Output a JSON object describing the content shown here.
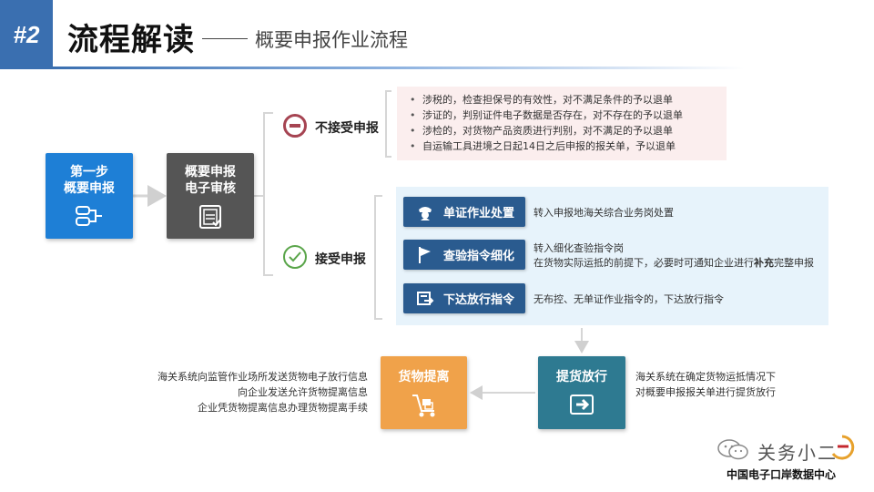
{
  "header": {
    "badge": "#2",
    "title": "流程解读",
    "subtitle": "概要申报作业流程"
  },
  "nodes": {
    "step1_label": "第一步\n概要申报",
    "review_label": "概要申报\n电子审核",
    "reject_label": "不接受申报",
    "accept_label": "接受申报",
    "pickup_label": "货物提离",
    "release_label": "提货放行"
  },
  "reject_reasons": [
    "涉税的，检查担保号的有效性，对不满足条件的予以退单",
    "涉证的，判别证件电子数据是否存在，对不存在的予以退单",
    "涉检的，对货物产品资质进行判别，对不满足的予以退单",
    "自运输工具进境之日起14日之后申报的报关单，予以退单"
  ],
  "accept_actions": [
    {
      "label": "单证作业处置",
      "icon": "officer-cap-icon",
      "desc_lines": [
        "转入申报地海关综合业务岗处置"
      ]
    },
    {
      "label": "查验指令细化",
      "icon": "flag-icon",
      "desc_lines": [
        "转入细化查验指令岗",
        "在货物实际运抵的前提下，必要时可通知企业进行补充完整申报"
      ]
    },
    {
      "label": "下达放行指令",
      "icon": "release-instruction-icon",
      "desc_lines": [
        "无布控、无单证作业指令的，下达放行指令"
      ]
    }
  ],
  "release_desc": [
    "海关系统在确定货物运抵情况下",
    "对概要申报报关单进行提货放行"
  ],
  "pickup_desc": [
    "海关系统向监管作业场所发送货物电子放行信息",
    "向企业发送允许货物提离信息",
    "企业凭货物提离信息办理货物提离手续"
  ],
  "watermark": {
    "name": "关务小二",
    "org": "中国电子口岸数据中心"
  },
  "colors": {
    "badge": "#3a6fb0",
    "step1": "#1e7fd6",
    "review": "#555555",
    "reject": "#a64452",
    "accept": "#5aa54a",
    "tag": "#2a5b8f",
    "pickup": "#f0a24a",
    "release": "#2e7a91"
  }
}
